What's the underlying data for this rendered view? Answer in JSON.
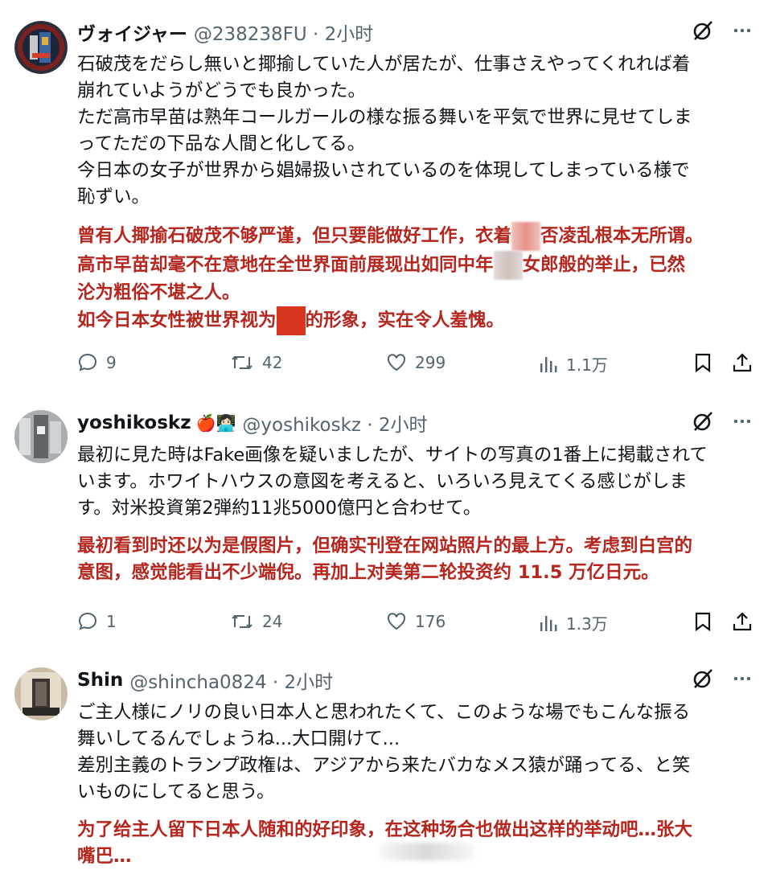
{
  "tweets": [
    {
      "name": "ヴォイジャー",
      "handle": "@238238FU · 2小时",
      "jp_lines": [
        "石破茂をだらし無いと揶揄していた人が居たが、仕事さえやってくれれば着",
        "崩れていようがどうでも良かった。",
        "ただ高市早苗は熟年コールガールの様な振る舞いを平気で世界に見せてしま",
        "ってただの下品な人間と化してる。",
        "今日本の女子が世界から娼婦扱いされているのを体現してしまっている様で",
        "恥ずい。"
      ],
      "cn_lines": [
        [
          "曾有人揶揄石破茂不够严谨，但只要能做好工作，衣着",
          "否凌乱根本无所谓。"
        ],
        [
          "高市早苗却毫不在意地在全世界面前展现出如同中年",
          "女郎般的举止，已然"
        ],
        [
          "沦为粗俗不堪之人。"
        ],
        [
          "如今日本女性被世界视为",
          "的形象，实在令人羞愧。"
        ]
      ],
      "replies": "9",
      "retweets": "42",
      "likes": "299",
      "views": "1.1万"
    },
    {
      "name": "yoshikoskz",
      "emoji": "🍎👩🏻‍💻",
      "handle": "@yoshikoskz · 2小时",
      "jp_lines": [
        "最初に見た時はFake画像を疑いましたが、サイトの写真の1番上に掲載されて",
        "います。ホワイトハウスの意図を考えると、いろいろ見えてくる感じがしま",
        "す。対米投資第2弾約11兆5000億円と合わせて。"
      ],
      "cn_lines": [
        [
          "最初看到时还以为是假图片，但确实刊登在网站照片的最上方。考虑到白宫的"
        ],
        [
          "意图，感觉能看出不少端倪。再加上对美第二轮投资约 11.5 万亿日元。"
        ]
      ],
      "replies": "1",
      "retweets": "24",
      "likes": "176",
      "views": "1.3万"
    },
    {
      "name": "Shin",
      "handle": "@shincha0824 · 2小时",
      "jp_lines": [
        "ご主人様にノリの良い日本人と思われたくて、このような場でもこんな振る",
        "舞いしてるんでしょうね...大口開けて...",
        "差別主義のトランプ政権は、アジアから来たバカなメス猿が踊ってる、と笑",
        "いものにしてると思う。"
      ],
      "cn_lines": [
        [
          "为了给主人留下日本人随和的好印象，在这种场合也做出这样的举动吧…张大"
        ],
        [
          "嘴巴…"
        ]
      ]
    }
  ],
  "colors": {
    "text": "#0f1419",
    "secondary": "#536471",
    "translation_red": "#b5261e",
    "redaction_red": "#d8351f"
  },
  "icons": [
    "grok-icon",
    "more-icon",
    "reply-icon",
    "retweet-icon",
    "like-icon",
    "views-icon",
    "bookmark-icon",
    "share-icon"
  ]
}
